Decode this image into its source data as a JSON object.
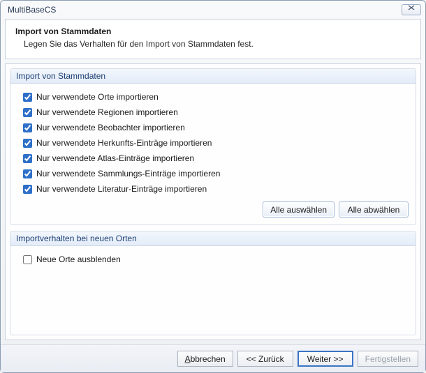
{
  "window": {
    "title": "MultiBaseCS"
  },
  "header": {
    "title": "Import von Stammdaten",
    "subtitle": "Legen Sie das Verhalten für den Import von Stammdaten fest."
  },
  "group1": {
    "title": "Import von Stammdaten",
    "checks": [
      "Nur verwendete Orte importieren",
      "Nur verwendete Regionen importieren",
      "Nur verwendete Beobachter importieren",
      "Nur verwendete Herkunfts-Einträge importieren",
      "Nur verwendete Atlas-Einträge importieren",
      "Nur verwendete Sammlungs-Einträge importieren",
      "Nur verwendete Literatur-Einträge importieren"
    ],
    "btnSelectAll": "Alle auswählen",
    "btnDeselectAll": "Alle abwählen"
  },
  "group2": {
    "title": "Importverhalten bei neuen Orten",
    "check": "Neue Orte ausblenden"
  },
  "footer": {
    "cancel_pre": "",
    "cancel_key": "A",
    "cancel_post": "bbrechen",
    "back": "<< Zurück",
    "next": "Weiter >>",
    "finish": "Fertigstellen"
  }
}
